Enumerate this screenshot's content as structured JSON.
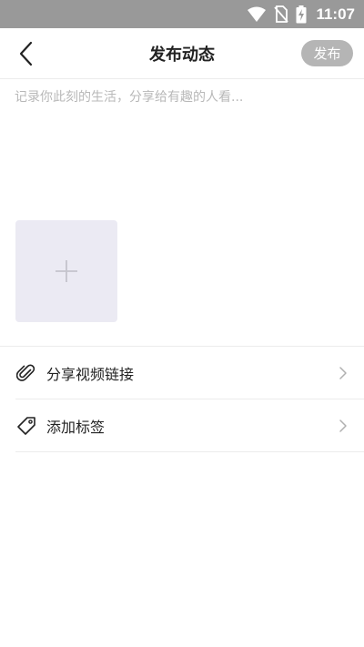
{
  "status_bar": {
    "time": "11:07",
    "icons": [
      "wifi-icon",
      "no-sim-icon",
      "battery-charging-icon"
    ]
  },
  "nav": {
    "back_icon": "chevron-left-icon",
    "title": "发布动态",
    "publish_label": "发布"
  },
  "composer": {
    "placeholder": "记录你此刻的生活，分享给有趣的人看...",
    "value": "",
    "add_photo_icon": "plus-icon"
  },
  "options": [
    {
      "icon": "paperclip-icon",
      "label": "分享视频链接"
    },
    {
      "icon": "tag-icon",
      "label": "添加标签"
    }
  ],
  "colors": {
    "status_bar": "#999999",
    "publish_button": "#b5b5b5",
    "photo_tile": "#ebeaf3",
    "placeholder": "#b8b8b8",
    "divider": "#ececec"
  }
}
